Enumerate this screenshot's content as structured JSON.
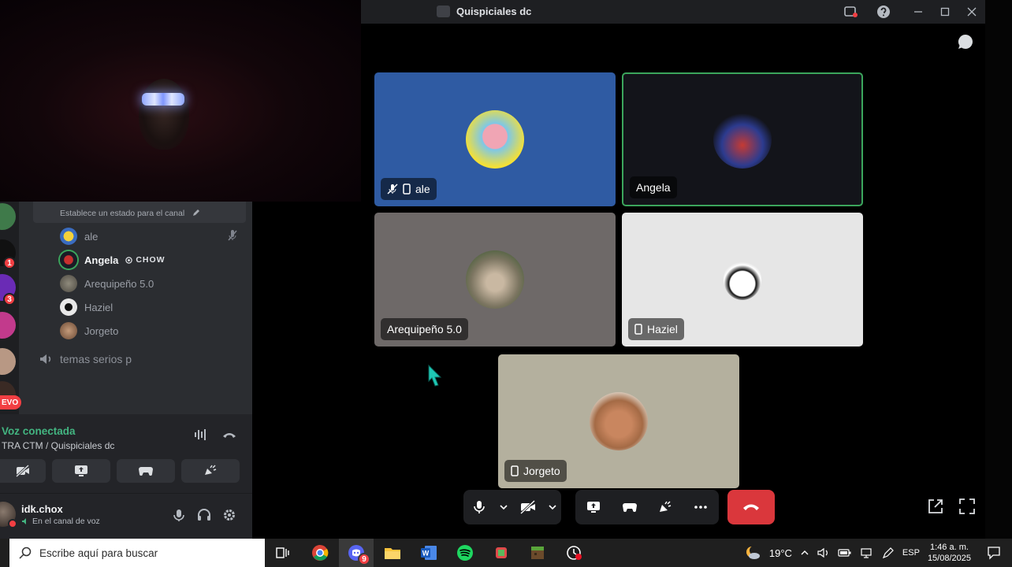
{
  "window": {
    "title": "Quispiciales dc"
  },
  "channel": {
    "status_placeholder": "Establece un estado para el canal",
    "members": [
      {
        "name": "ale",
        "muted": true
      },
      {
        "name": "Angela",
        "active": true,
        "tag": "CHOW"
      },
      {
        "name": "Arequipeño 5.0"
      },
      {
        "name": "Haziel"
      },
      {
        "name": "Jorgeto"
      }
    ],
    "other_channel": "temas serios p"
  },
  "guild_badges": {
    "first": "1",
    "second": "3",
    "new": "EVO"
  },
  "voice": {
    "title": "Voz conectada",
    "server": "TRA CTM / Quispiciales dc"
  },
  "user": {
    "name": "idk.chox",
    "status": "En el canal de voz"
  },
  "tiles": [
    {
      "name": "ale",
      "bg": "#2f5ba3"
    },
    {
      "name": "Angela",
      "bg": "#13141a",
      "speaking_color": "#3ba55c"
    },
    {
      "name": "Arequipeño 5.0",
      "bg": "#6e6968"
    },
    {
      "name": "Haziel",
      "bg": "#e6e6e6"
    },
    {
      "name": "Jorgeto",
      "bg": "#b4b09e"
    }
  ],
  "taskbar": {
    "search_placeholder": "Escribe aquí para buscar",
    "weather": "19°C",
    "lang": "ESP",
    "time": "1:46 a. m.",
    "date": "15/08/2025",
    "discord_badge": "9"
  },
  "icons": [
    "search-icon",
    "mic-icon",
    "camera-off-icon",
    "screen-share-icon",
    "activity-icon",
    "soundboard-icon",
    "more-icon",
    "hangup-icon",
    "popout-icon",
    "fullscreen-icon",
    "chat-icon",
    "headphones-icon",
    "gear-icon",
    "help-icon"
  ]
}
